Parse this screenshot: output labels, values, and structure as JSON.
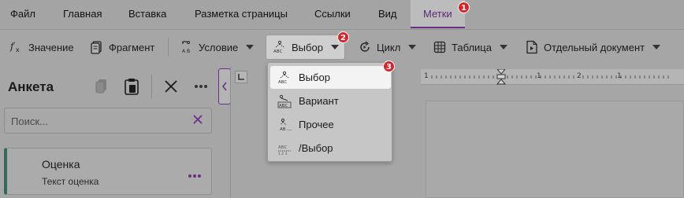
{
  "tabs": [
    {
      "label": "Файл"
    },
    {
      "label": "Главная"
    },
    {
      "label": "Вставка"
    },
    {
      "label": "Разметка страницы"
    },
    {
      "label": "Ссылки"
    },
    {
      "label": "Вид"
    },
    {
      "label": "Метки",
      "active": true
    }
  ],
  "toolbar": {
    "value_label": "Значение",
    "fragment_label": "Фрагмент",
    "condition_label": "Условие",
    "choice_label": "Выбор",
    "loop_label": "Цикл",
    "table_label": "Таблица",
    "separate_doc_label": "Отдельный документ"
  },
  "badges": {
    "one": "1",
    "two": "2",
    "three": "3"
  },
  "pane": {
    "title": "Анкета",
    "search_placeholder": "Поиск...",
    "card": {
      "title": "Оценка",
      "subtitle": "Текст оценка"
    }
  },
  "ruler": {
    "labels": [
      "1",
      "1",
      "1",
      "2",
      "1"
    ]
  },
  "dropdown": {
    "items": [
      {
        "label": "Выбор",
        "icon": "choice-icon"
      },
      {
        "label": "Вариант",
        "icon": "variant-icon"
      },
      {
        "label": "Прочее",
        "icon": "other-icon"
      },
      {
        "label": "/Выбор",
        "icon": "end-choice-icon"
      }
    ]
  },
  "colors": {
    "accent": "#6a2e86",
    "badge": "#d8232a",
    "card_stripe": "#2f6a5a"
  }
}
